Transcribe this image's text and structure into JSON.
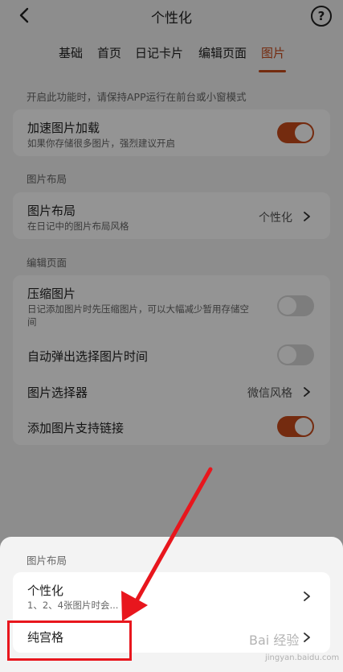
{
  "header": {
    "title": "个性化",
    "help_glyph": "?"
  },
  "tabs": [
    {
      "label": "基础",
      "active": false
    },
    {
      "label": "首页",
      "active": false
    },
    {
      "label": "日记卡片",
      "active": false
    },
    {
      "label": "编辑页面",
      "active": false
    },
    {
      "label": "图片",
      "active": true
    }
  ],
  "notice": "开启此功能时，请保持APP运行在前台或小窗模式",
  "accelerate": {
    "title": "加速图片加载",
    "subtitle": "如果你存储很多图片，强烈建议开启",
    "enabled": true
  },
  "layout_section": {
    "label": "图片布局",
    "row_title": "图片布局",
    "row_subtitle": "在日记中的图片布局风格",
    "value": "个性化"
  },
  "edit_section": {
    "label": "编辑页面",
    "compress": {
      "title": "压缩图片",
      "subtitle_line1": "日记添加图片时先压缩图片，可以大幅减少暂用存储空",
      "subtitle_line2": "间",
      "enabled": false
    },
    "auto_popup": {
      "title": "自动弹出选择图片时间",
      "enabled": false
    },
    "picker": {
      "title": "图片选择器",
      "value": "微信风格"
    },
    "link_support": {
      "title": "添加图片支持链接",
      "enabled": true
    }
  },
  "sheet": {
    "label": "图片布局",
    "options": [
      {
        "title": "个性化",
        "subtitle": "1、2、4张图片时会..."
      },
      {
        "title": "纯宫格"
      }
    ]
  },
  "watermark": {
    "text": "Bai 经验",
    "sub": "jingyan.baidu.com"
  },
  "colors": {
    "accent": "#c84a1b",
    "annotation_red": "#e8161d"
  }
}
